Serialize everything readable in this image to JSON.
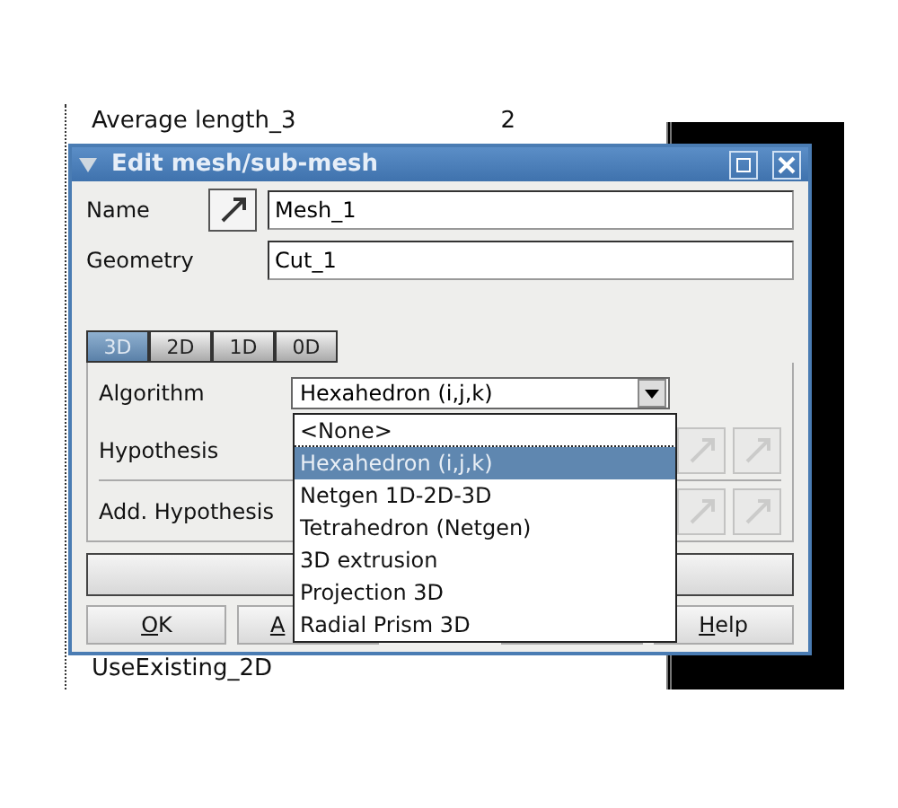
{
  "background": {
    "tree_rows": [
      {
        "label": "Average length_3",
        "value": "2"
      },
      {
        "label": "UseExisting_2D"
      }
    ]
  },
  "dialog": {
    "title": "Edit mesh/sub-mesh",
    "name": {
      "label": "Name",
      "value": "Mesh_1"
    },
    "geometry": {
      "label": "Geometry",
      "value": "Cut_1"
    },
    "tabs": [
      {
        "label": "3D",
        "selected": true
      },
      {
        "label": "2D",
        "selected": false
      },
      {
        "label": "1D",
        "selected": false
      },
      {
        "label": "0D",
        "selected": false
      }
    ],
    "algorithm": {
      "label": "Algorithm",
      "value": "Hexahedron (i,j,k)"
    },
    "hypothesis_rows": [
      {
        "label": "Hypothesis",
        "disabled": true
      },
      {
        "label": "Add. Hypothesis",
        "disabled": true
      }
    ],
    "dropdown": [
      {
        "label": "<None>",
        "selected": false
      },
      {
        "label": "Hexahedron (i,j,k)",
        "selected": true
      },
      {
        "label": "Netgen 1D-2D-3D",
        "selected": false
      },
      {
        "label": "Tetrahedron (Netgen)",
        "selected": false
      },
      {
        "label": "3D extrusion",
        "selected": false
      },
      {
        "label": "Projection 3D",
        "selected": false
      },
      {
        "label": "Radial Prism 3D",
        "selected": false
      }
    ],
    "buttons": [
      {
        "label": "OK"
      },
      {
        "label": "A"
      },
      {
        "label": "Help"
      }
    ]
  }
}
